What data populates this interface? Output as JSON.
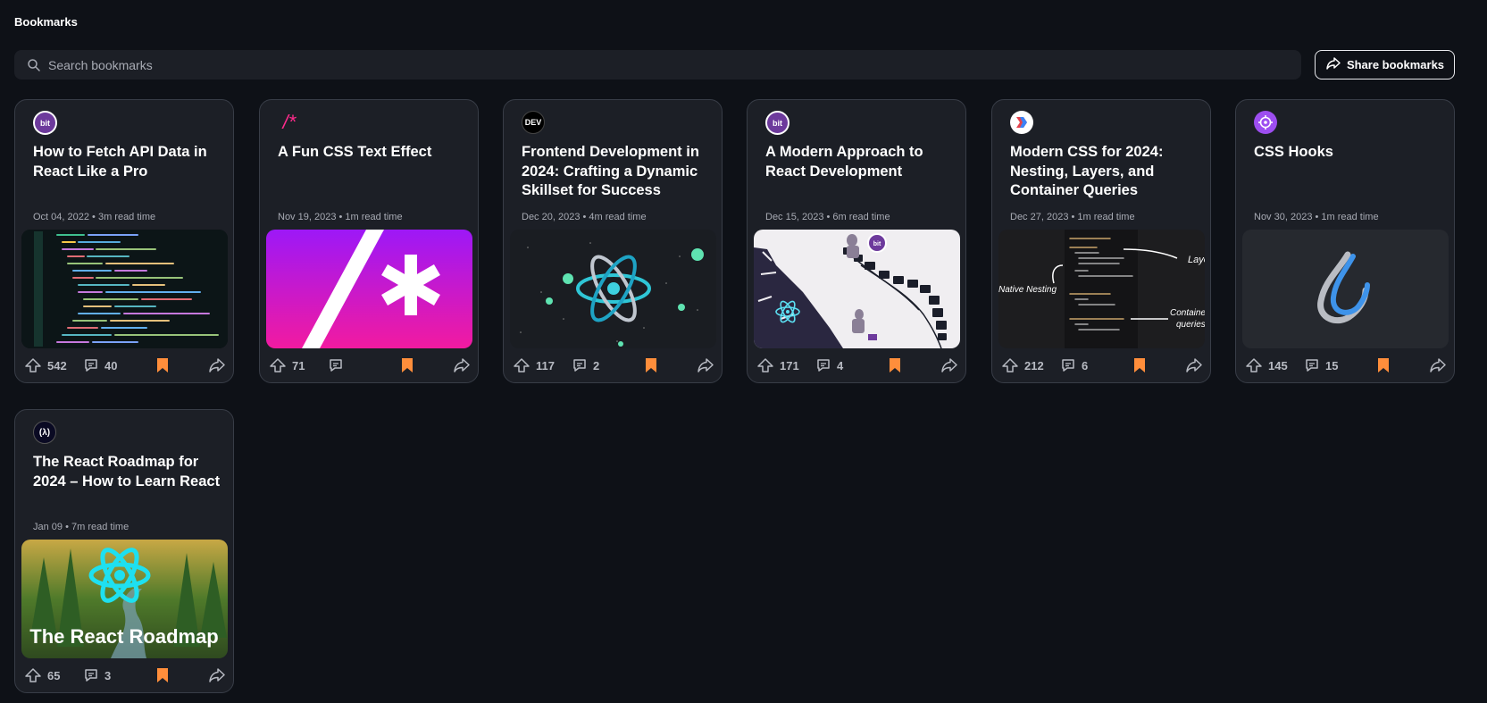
{
  "page": {
    "title": "Bookmarks"
  },
  "search": {
    "placeholder": "Search bookmarks"
  },
  "share_button": {
    "label": "Share bookmarks"
  },
  "colors": {
    "background": "#0e1117",
    "card": "#1c1f26",
    "border": "#383d47",
    "bookmark": "#ff8e3b"
  },
  "cards": [
    {
      "source": "bit",
      "title": "How to Fetch API Data in React Like a Pro",
      "meta": "Oct 04, 2022 • 3m read time",
      "upvotes": "542",
      "comments": "40"
    },
    {
      "source": "/*",
      "title": "A Fun CSS Text Effect",
      "meta": "Nov 19, 2023 • 1m read time",
      "upvotes": "71",
      "comments": ""
    },
    {
      "source": "DEV",
      "title": "Frontend Development in 2024: Crafting a Dynamic Skillset for Success",
      "meta": "Dec 20, 2023 • 4m read time",
      "upvotes": "117",
      "comments": "2"
    },
    {
      "source": "bit",
      "title": "A Modern Approach to React Development",
      "meta": "Dec 15, 2023 • 6m read time",
      "upvotes": "171",
      "comments": "4"
    },
    {
      "source": "",
      "title": "Modern CSS for 2024: Nesting, Layers, and Container Queries",
      "meta": "Dec 27, 2023 • 1m read time",
      "upvotes": "212",
      "comments": "6"
    },
    {
      "source": "",
      "title": "CSS Hooks",
      "meta": "Nov 30, 2023 • 1m read time",
      "upvotes": "145",
      "comments": "15"
    },
    {
      "source": "(λ)",
      "title": "The React Roadmap for 2024 – How to Learn React",
      "meta": "Jan 09 • 7m read time",
      "upvotes": "65",
      "comments": "3"
    }
  ],
  "thumb_text": {
    "bit_badge": "bit",
    "layers": "Layers",
    "native_nesting": "Native Nesting",
    "container_queries_1": "Container",
    "container_queries_2": "queries",
    "react_roadmap": "The React Roadmap"
  }
}
